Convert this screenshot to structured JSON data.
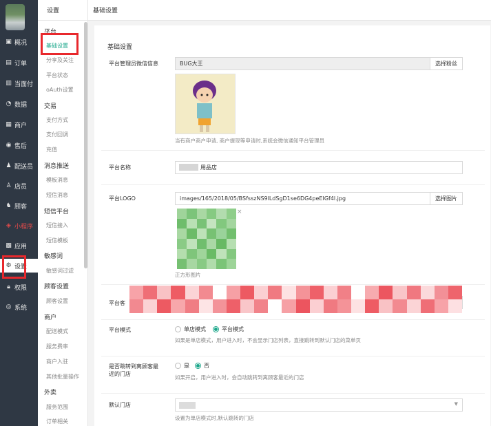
{
  "left_nav": [
    {
      "label": "概况",
      "icon": "overview-icon"
    },
    {
      "label": "订单",
      "icon": "order-icon"
    },
    {
      "label": "当面付",
      "icon": "pay-icon"
    },
    {
      "label": "数据",
      "icon": "data-icon"
    },
    {
      "label": "商户",
      "icon": "merchant-icon"
    },
    {
      "label": "售后",
      "icon": "aftersale-icon"
    },
    {
      "label": "配送员",
      "icon": "courier-icon"
    },
    {
      "label": "店员",
      "icon": "clerk-icon"
    },
    {
      "label": "顾客",
      "icon": "customer-icon"
    },
    {
      "label": "小程序",
      "icon": "miniapp-icon"
    },
    {
      "label": "应用",
      "icon": "apps-icon"
    },
    {
      "label": "设置",
      "icon": "gear-icon"
    },
    {
      "label": "权限",
      "icon": "lock-icon"
    },
    {
      "label": "系统",
      "icon": "system-icon"
    }
  ],
  "sub_nav": {
    "title": "设置",
    "groups": [
      {
        "title": "平台",
        "items": [
          "基础设置",
          "分享及关注",
          "平台状态",
          "oAuth设置"
        ]
      },
      {
        "title": "交易",
        "items": [
          "支付方式",
          "支付回调",
          "充值"
        ]
      },
      {
        "title": "消息推送",
        "items": [
          "模板消息",
          "短信消息"
        ]
      },
      {
        "title": "短信平台",
        "items": [
          "短信接入",
          "短信模板"
        ]
      },
      {
        "title": "敏感词",
        "items": [
          "敏感词过滤"
        ]
      },
      {
        "title": "顾客设置",
        "items": [
          "顾客设置"
        ]
      },
      {
        "title": "商户",
        "items": [
          "配送模式",
          "服务费率",
          "商户入驻",
          "其他批量操作"
        ]
      },
      {
        "title": "外卖",
        "items": [
          "服务范围",
          "订单相关"
        ]
      }
    ]
  },
  "header": {
    "title": "基础设置"
  },
  "form": {
    "section_title": "基础设置",
    "admin": {
      "label": "平台管理员微信信息",
      "value": "BUG大王",
      "button": "选择粉丝",
      "hint": "当有商户商户申请, 商户提现等申请时,系统会微信通知平台管理员"
    },
    "platform_name": {
      "label": "平台名称",
      "value": "用品店"
    },
    "logo": {
      "label": "平台LOGO",
      "value": "images/165/2018/05/BSfsszNS9lLdSgD1se6DG4peEIGf4l.jpg",
      "button": "选择图片",
      "remove": "×",
      "hint": "正方形图片"
    },
    "platform_mode": {
      "label": "平台模式",
      "options": [
        "单店模式",
        "平台模式"
      ],
      "selected": "平台模式",
      "hint": "如果是单店模式，用户进入时，不会显示门店列表，直接跳转到默认门店的菜单页"
    },
    "jump_store": {
      "label_line1": "是否跳转到离顾客最",
      "label_line2": "近的门店",
      "options": [
        "是",
        "否"
      ],
      "selected": "否",
      "hint": "如果开启，用户进入时，会自动跳转到离顾客最近的门店"
    },
    "default_store": {
      "label": "默认门店",
      "hint": "设置为单店模式时,默认跳转的门店"
    }
  },
  "colors": {
    "accent": "#18a689",
    "sidebar_bg": "#2f3844",
    "highlight_red": "#e8282c"
  }
}
